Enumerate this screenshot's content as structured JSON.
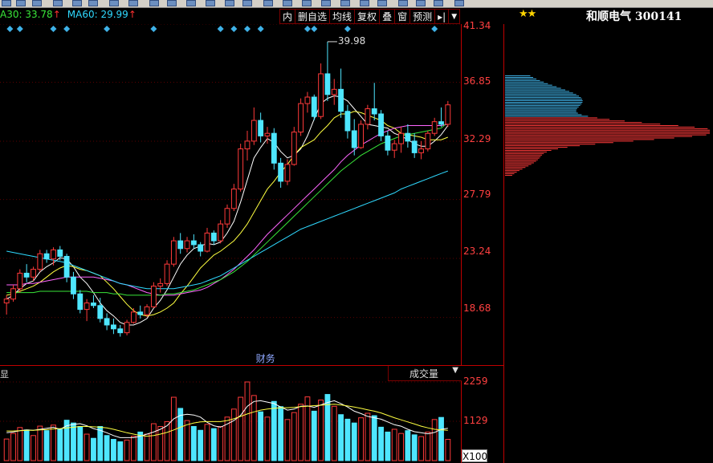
{
  "toolbar": {
    "icons": [
      "toolbar-icon-1",
      "toolbar-icon-2",
      "toolbar-icon-3"
    ]
  },
  "legend": {
    "ma30": "A30: 33.78",
    "ma60": "MA60: 29.99",
    "up_arrow": "↑"
  },
  "buttons": [
    "内",
    "删自选",
    "均线",
    "复权",
    "叠",
    "窗",
    "预测"
  ],
  "button_icons": {
    "next": "▸|",
    "more": "▼"
  },
  "stock": {
    "stars": "★★",
    "name": "和顺电气 300141"
  },
  "price_axis": [
    "41.34",
    "36.85",
    "32.29",
    "27.79",
    "23.24",
    "18.68"
  ],
  "max_label": "39.98",
  "caiwu_label": "财务",
  "volume": {
    "selector_label": "成交量",
    "left_label": "显",
    "ticks": [
      "2259",
      "1129"
    ],
    "unit_button": "X100"
  },
  "colors": {
    "up": "#ff3a3a",
    "down": "#4ee6ff",
    "ma5": "#ffffff",
    "ma10": "#ffff40",
    "ma20": "#ff66ff",
    "ma30": "#39e639",
    "ma60": "#2fd9ff"
  },
  "chart_data": {
    "type": "line",
    "price_ylim": [
      15.0,
      41.34
    ],
    "candles": [
      [
        19.8,
        20.4,
        18.9,
        20.1
      ],
      [
        20.1,
        21.2,
        19.9,
        20.9
      ],
      [
        20.9,
        22.4,
        20.6,
        22.1
      ],
      [
        22.1,
        22.8,
        21.4,
        21.8
      ],
      [
        21.8,
        22.6,
        21.5,
        22.4
      ],
      [
        22.4,
        23.9,
        22.2,
        23.6
      ],
      [
        23.6,
        23.9,
        22.9,
        23.2
      ],
      [
        23.2,
        24.1,
        22.7,
        23.9
      ],
      [
        23.9,
        24.2,
        23.1,
        23.4
      ],
      [
        23.4,
        23.6,
        21.4,
        21.8
      ],
      [
        21.8,
        22.2,
        20.1,
        20.5
      ],
      [
        20.5,
        20.8,
        19.0,
        19.3
      ],
      [
        19.3,
        20.1,
        18.4,
        19.8
      ],
      [
        19.8,
        20.4,
        19.4,
        19.6
      ],
      [
        19.6,
        20.2,
        18.3,
        18.6
      ],
      [
        18.6,
        19.0,
        17.7,
        18.1
      ],
      [
        18.1,
        18.6,
        17.4,
        17.8
      ],
      [
        17.8,
        18.1,
        17.2,
        17.5
      ],
      [
        17.5,
        18.5,
        17.3,
        18.3
      ],
      [
        18.3,
        19.4,
        18.2,
        19.1
      ],
      [
        19.1,
        19.6,
        18.6,
        18.9
      ],
      [
        18.9,
        19.7,
        18.7,
        19.5
      ],
      [
        19.5,
        21.4,
        19.4,
        21.1
      ],
      [
        21.1,
        21.7,
        20.6,
        21.3
      ],
      [
        21.3,
        23.1,
        21.1,
        22.8
      ],
      [
        22.8,
        24.9,
        22.6,
        24.6
      ],
      [
        24.6,
        25.2,
        23.6,
        24.0
      ],
      [
        24.0,
        24.9,
        23.7,
        24.6
      ],
      [
        24.6,
        25.1,
        24.0,
        24.3
      ],
      [
        24.3,
        24.5,
        23.4,
        23.8
      ],
      [
        23.8,
        25.6,
        23.7,
        25.2
      ],
      [
        25.2,
        25.4,
        24.3,
        24.6
      ],
      [
        24.6,
        26.2,
        24.4,
        25.9
      ],
      [
        25.9,
        27.4,
        25.6,
        27.1
      ],
      [
        27.1,
        29.0,
        26.9,
        28.6
      ],
      [
        28.6,
        32.1,
        28.4,
        31.7
      ],
      [
        31.7,
        33.1,
        30.8,
        32.3
      ],
      [
        32.3,
        34.9,
        32.0,
        33.9
      ],
      [
        33.9,
        34.5,
        32.2,
        32.7
      ],
      [
        32.7,
        33.4,
        32.1,
        32.9
      ],
      [
        32.9,
        33.3,
        30.1,
        30.6
      ],
      [
        30.6,
        31.0,
        28.7,
        29.2
      ],
      [
        29.2,
        30.9,
        28.9,
        30.5
      ],
      [
        30.5,
        33.4,
        30.4,
        33.0
      ],
      [
        33.0,
        35.6,
        32.7,
        35.2
      ],
      [
        35.2,
        36.1,
        34.5,
        35.7
      ],
      [
        35.7,
        35.9,
        33.9,
        34.2
      ],
      [
        34.2,
        38.3,
        34.0,
        37.5
      ],
      [
        37.5,
        39.98,
        35.4,
        35.9
      ],
      [
        35.9,
        37.1,
        35.1,
        36.3
      ],
      [
        36.3,
        37.9,
        34.1,
        34.6
      ],
      [
        34.6,
        35.1,
        32.5,
        33.1
      ],
      [
        33.1,
        34.0,
        31.2,
        31.8
      ],
      [
        31.8,
        33.9,
        31.7,
        33.6
      ],
      [
        33.6,
        35.1,
        33.2,
        34.8
      ],
      [
        34.8,
        36.8,
        33.9,
        34.4
      ],
      [
        34.4,
        34.7,
        32.3,
        32.7
      ],
      [
        32.7,
        33.1,
        31.2,
        31.6
      ],
      [
        31.6,
        32.4,
        31.0,
        32.1
      ],
      [
        32.1,
        33.4,
        31.4,
        32.9
      ],
      [
        32.9,
        33.6,
        31.8,
        32.3
      ],
      [
        32.3,
        32.9,
        31.0,
        31.4
      ],
      [
        31.4,
        32.3,
        30.9,
        31.7
      ],
      [
        31.7,
        33.1,
        31.5,
        32.9
      ],
      [
        32.9,
        34.1,
        32.7,
        33.8
      ],
      [
        33.8,
        34.9,
        33.4,
        33.6
      ],
      [
        33.6,
        35.4,
        33.4,
        35.1
      ]
    ],
    "ma_series": {
      "ma5": [
        20.1,
        20.4,
        20.9,
        21.3,
        21.5,
        22.2,
        22.6,
        22.9,
        23.3,
        23.2,
        22.6,
        21.8,
        21.3,
        20.6,
        19.8,
        19.2,
        18.8,
        18.3,
        18.1,
        18.1,
        18.3,
        18.6,
        19.4,
        20.0,
        20.8,
        21.8,
        22.8,
        23.5,
        24.0,
        24.2,
        24.4,
        24.3,
        24.5,
        25.2,
        26.1,
        27.6,
        29.3,
        31.0,
        31.8,
        32.5,
        32.2,
        31.5,
        31.0,
        31.2,
        31.7,
        32.7,
        34.0,
        35.2,
        35.6,
        35.8,
        35.7,
        35.4,
        34.8,
        34.2,
        33.6,
        33.5,
        33.4,
        33.3,
        32.9,
        32.7,
        32.4,
        32.1,
        31.9,
        31.9,
        32.3,
        32.8,
        33.5
      ],
      "ma10": [
        20.4,
        20.5,
        20.7,
        20.9,
        21.1,
        21.4,
        21.8,
        22.2,
        22.5,
        22.7,
        22.6,
        22.4,
        22.3,
        22.1,
        21.9,
        21.4,
        20.9,
        20.3,
        19.7,
        19.2,
        18.9,
        18.8,
        18.9,
        19.1,
        19.4,
        19.8,
        20.5,
        21.1,
        21.8,
        22.5,
        23.0,
        23.5,
        23.8,
        24.2,
        24.6,
        25.2,
        25.9,
        26.8,
        27.7,
        28.6,
        29.2,
        29.9,
        30.5,
        31.2,
        31.8,
        32.1,
        32.4,
        33.0,
        33.5,
        34.1,
        34.4,
        34.4,
        34.6,
        34.5,
        34.3,
        34.1,
        33.9,
        33.5,
        33.3,
        32.9,
        32.8,
        32.7,
        32.6,
        32.4,
        32.4,
        32.4,
        32.6
      ],
      "ma20": [
        21.2,
        21.2,
        21.2,
        21.3,
        21.3,
        21.4,
        21.5,
        21.6,
        21.7,
        21.8,
        21.8,
        21.8,
        21.8,
        21.8,
        21.7,
        21.6,
        21.5,
        21.3,
        21.2,
        21.0,
        20.8,
        20.6,
        20.5,
        20.4,
        20.4,
        20.4,
        20.5,
        20.6,
        20.7,
        20.8,
        21.0,
        21.3,
        21.6,
        22.0,
        22.4,
        22.9,
        23.4,
        23.9,
        24.5,
        25.1,
        25.6,
        26.1,
        26.6,
        27.1,
        27.6,
        28.1,
        28.6,
        29.1,
        29.6,
        30.1,
        30.7,
        31.2,
        31.6,
        32.0,
        32.3,
        32.6,
        32.9,
        33.1,
        33.3,
        33.4,
        33.5,
        33.5,
        33.5,
        33.5,
        33.5,
        33.5,
        33.6
      ],
      "ma30": [
        20.6,
        20.6,
        20.6,
        20.6,
        20.6,
        20.7,
        20.7,
        20.7,
        20.7,
        20.7,
        20.7,
        20.7,
        20.7,
        20.6,
        20.6,
        20.6,
        20.5,
        20.5,
        20.4,
        20.4,
        20.4,
        20.4,
        20.4,
        20.4,
        20.5,
        20.5,
        20.6,
        20.7,
        20.8,
        21.0,
        21.2,
        21.4,
        21.6,
        21.9,
        22.2,
        22.6,
        23.0,
        23.5,
        24.0,
        24.5,
        25.0,
        25.5,
        26.0,
        26.5,
        27.0,
        27.5,
        28.0,
        28.5,
        29.0,
        29.5,
        30.0,
        30.4,
        30.8,
        31.2,
        31.5,
        31.8,
        32.1,
        32.3,
        32.5,
        32.7,
        32.8,
        32.9,
        33.0,
        33.1,
        33.2,
        33.3,
        33.78
      ],
      "ma60": [
        23.8,
        23.7,
        23.6,
        23.5,
        23.4,
        23.3,
        23.2,
        23.1,
        23.0,
        22.9,
        22.7,
        22.5,
        22.3,
        22.1,
        21.9,
        21.7,
        21.5,
        21.3,
        21.2,
        21.1,
        21.0,
        20.9,
        20.9,
        20.9,
        20.9,
        20.9,
        21.0,
        21.1,
        21.2,
        21.3,
        21.5,
        21.7,
        21.9,
        22.2,
        22.5,
        22.8,
        23.1,
        23.4,
        23.7,
        24.0,
        24.3,
        24.6,
        24.9,
        25.2,
        25.5,
        25.7,
        25.9,
        26.1,
        26.3,
        26.5,
        26.7,
        26.9,
        27.1,
        27.3,
        27.5,
        27.7,
        27.9,
        28.1,
        28.3,
        28.6,
        28.8,
        29.0,
        29.2,
        29.4,
        29.6,
        29.8,
        29.99
      ]
    },
    "volume_ylim": [
      0,
      2259
    ],
    "volumes": [
      620,
      780,
      950,
      880,
      720,
      990,
      860,
      1020,
      900,
      1160,
      1080,
      980,
      760,
      640,
      980,
      720,
      610,
      540,
      590,
      700,
      820,
      760,
      1060,
      980,
      1120,
      1820,
      1500,
      1150,
      980,
      870,
      1040,
      920,
      980,
      1250,
      1480,
      1820,
      2259,
      1870,
      1400,
      1250,
      1700,
      1550,
      1180,
      1380,
      1620,
      1830,
      1420,
      1740,
      1900,
      1560,
      1320,
      1190,
      1080,
      1230,
      1360,
      1290,
      960,
      820,
      900,
      780,
      860,
      740,
      690,
      820,
      1180,
      1240,
      610
    ],
    "volume_ma": {
      "ma5": [
        800,
        820,
        860,
        880,
        870,
        900,
        930,
        960,
        900,
        1000,
        1040,
        1060,
        1000,
        920,
        870,
        800,
        720,
        660,
        660,
        660,
        700,
        760,
        820,
        900,
        1000,
        1200,
        1300,
        1330,
        1310,
        1250,
        1100,
        1000,
        960,
        1050,
        1150,
        1300,
        1560,
        1700,
        1720,
        1680,
        1640,
        1540,
        1450,
        1480,
        1560,
        1570,
        1530,
        1600,
        1670,
        1720,
        1640,
        1540,
        1420,
        1350,
        1270,
        1230,
        1190,
        1110,
        1030,
        990,
        900,
        830,
        800,
        770,
        810,
        900,
        930
      ],
      "ma10": [
        850,
        850,
        860,
        870,
        870,
        880,
        890,
        910,
        920,
        940,
        960,
        980,
        980,
        970,
        960,
        940,
        900,
        850,
        800,
        760,
        720,
        700,
        720,
        760,
        810,
        880,
        960,
        1030,
        1080,
        1110,
        1120,
        1120,
        1120,
        1150,
        1200,
        1270,
        1340,
        1400,
        1450,
        1480,
        1500,
        1520,
        1520,
        1530,
        1550,
        1560,
        1580,
        1590,
        1610,
        1620,
        1600,
        1570,
        1540,
        1500,
        1460,
        1420,
        1370,
        1300,
        1230,
        1170,
        1110,
        1050,
        990,
        940,
        900,
        880,
        870
      ]
    }
  }
}
